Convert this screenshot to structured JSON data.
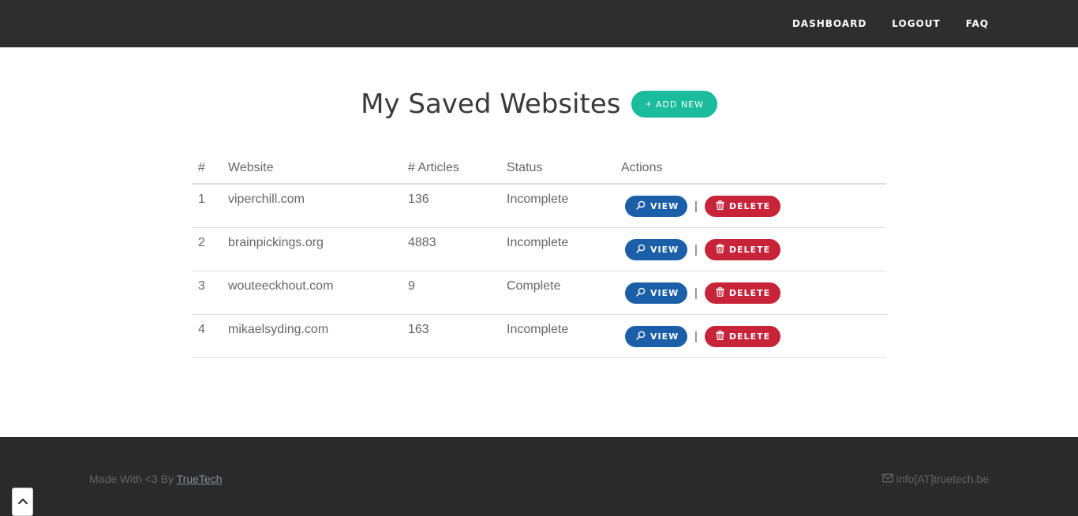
{
  "nav": {
    "links": [
      "DASHBOARD",
      "LOGOUT",
      "FAQ"
    ]
  },
  "main": {
    "title": "My Saved Websites",
    "add_button": {
      "icon": "plus-icon",
      "label": "ADD NEW",
      "color": "#1abc9c"
    }
  },
  "table": {
    "headers": [
      "#",
      "Website",
      "# Articles",
      "Status",
      "Actions"
    ],
    "rows": [
      {
        "num": "1",
        "website": "viperchill.com",
        "articles": "136",
        "status": "Incomplete"
      },
      {
        "num": "2",
        "website": "brainpickings.org",
        "articles": "4883",
        "status": "Incomplete"
      },
      {
        "num": "3",
        "website": "wouteeckhout.com",
        "articles": "9",
        "status": "Complete"
      },
      {
        "num": "4",
        "website": "mikaelsyding.com",
        "articles": "163",
        "status": "Incomplete"
      }
    ],
    "view_label": "VIEW",
    "delete_label": "DELETE",
    "separator": "|",
    "view_color": "#1a5fa8",
    "delete_color": "#c7243a"
  },
  "footer": {
    "made_with": "Made With <3 By ",
    "author_link": "TrueTech",
    "email": "info[AT]truetech.be"
  },
  "icons": {
    "view": "search-icon",
    "delete": "trash-icon",
    "email": "envelope-icon",
    "scroll_top": "chevron-up-icon"
  }
}
